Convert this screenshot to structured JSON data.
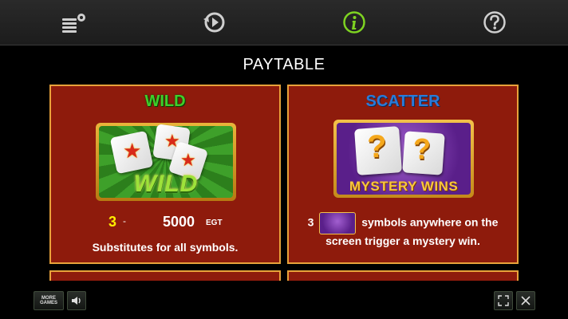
{
  "title": "PAYTABLE",
  "cards": {
    "wild": {
      "title": "WILD",
      "symbol_text": "WILD",
      "pay_count": "3",
      "pay_dash": "-",
      "pay_value": "5000",
      "pay_currency": "EGT",
      "description": "Substitutes for all symbols."
    },
    "scatter": {
      "title": "SCATTER",
      "symbol_text": "MYSTERY WINS",
      "symbol_glyph": "?",
      "count": "3",
      "description_line1": "symbols anywhere on the",
      "description_line2": "screen trigger a mystery win."
    }
  },
  "bottom": {
    "more_games_line1": "MORE",
    "more_games_line2": "GAMES"
  },
  "icons": {
    "nav": [
      "paytable-settings-icon",
      "history-replay-icon",
      "info-icon",
      "help-icon"
    ],
    "bottom": [
      "more-games-icon",
      "speaker-icon",
      "fullscreen-icon",
      "close-icon"
    ]
  },
  "colors": {
    "card_bg": "#8e1b0c",
    "card_border": "#e8a23a",
    "active_nav": "#7ed321",
    "wild_title": "#3fcf2a",
    "scatter_title": "#2a7bd8"
  }
}
